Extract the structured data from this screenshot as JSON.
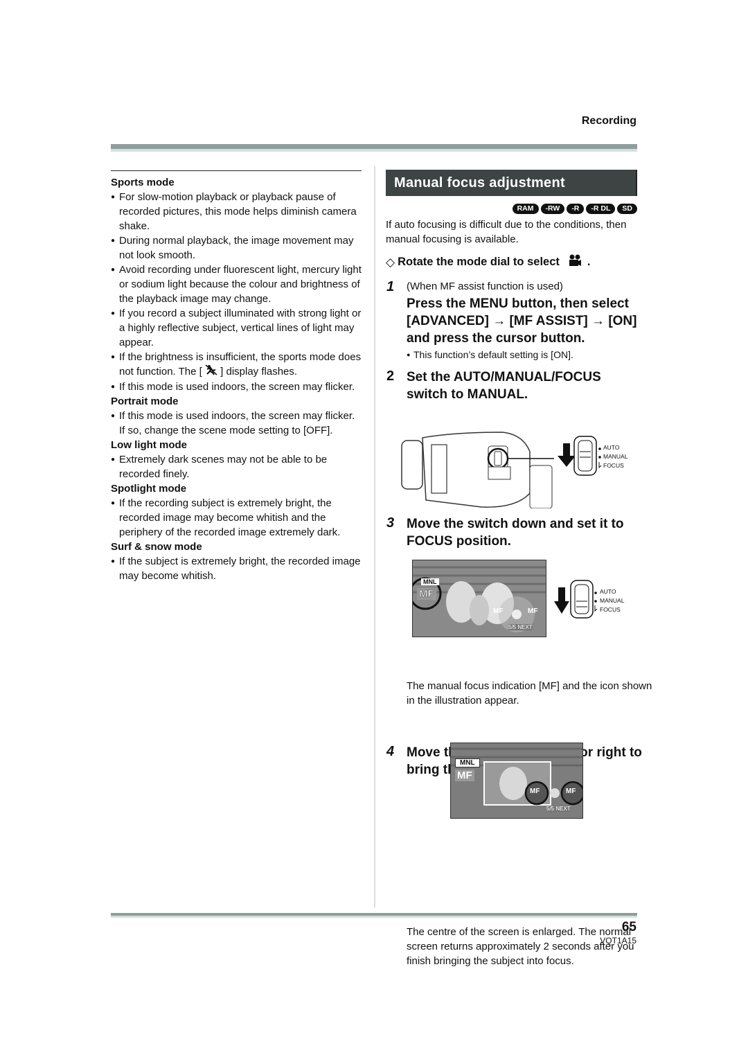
{
  "header": {
    "section": "Recording"
  },
  "left": {
    "sections": [
      {
        "title": "Sports mode",
        "bullets": [
          "For slow-motion playback or playback pause of recorded pictures, this mode helps diminish camera shake.",
          "During normal playback, the image movement may not look smooth.",
          "Avoid recording under fluorescent light, mercury light or sodium light because the colour and brightness of the playback image may change.",
          "If you record a subject illuminated with strong light or a highly reflective subject, vertical lines of light may appear.",
          "If the brightness is insufficient, the sports mode does not function. The [",
          "If this mode is used indoors, the screen may flicker."
        ],
        "bullet5_suffix": "] display flashes."
      },
      {
        "title": "Portrait mode",
        "bullets": [
          "If this mode is used indoors, the screen may flicker. If so, change the scene mode setting to [OFF]."
        ]
      },
      {
        "title": "Low light mode",
        "bullets": [
          "Extremely dark scenes may not be able to be recorded finely."
        ]
      },
      {
        "title": "Spotlight mode",
        "bullets": [
          "If the recording subject is extremely bright, the recorded image may become whitish and the periphery of the recorded image extremely dark."
        ]
      },
      {
        "title": "Surf & snow mode",
        "bullets": [
          "If the subject is extremely bright, the recorded image may become whitish."
        ]
      }
    ]
  },
  "right": {
    "title": "Manual focus adjustment",
    "badges": [
      "RAM",
      "-RW",
      "-R",
      "-R DL",
      "SD"
    ],
    "intro": "If auto focusing is difficult due to the conditions, then manual focusing is available.",
    "prep": {
      "symbol": "◇",
      "text": "Rotate the mode dial to select",
      "icon": "video-camera-icon",
      "suffix": "."
    },
    "steps": [
      {
        "num": "1",
        "lead": "(When MF assist function is used)",
        "head": "Press the MENU button, then select [ADVANCED] → [MF ASSIST] → [ON] and press the cursor button.",
        "note": "This function’s default setting is [ON]."
      },
      {
        "num": "2",
        "head": "Set the AUTO/MANUAL/FOCUS switch to MANUAL."
      },
      {
        "num": "3",
        "head": "Move the switch down and set it to FOCUS position.",
        "body": "The manual focus indication [MF] and the icon shown in the illustration appear."
      },
      {
        "num": "4",
        "head": "Move the cursor button left or right to bring the subject into focus.",
        "body": "The centre of the screen is enlarged. The normal screen returns approximately 2 seconds after you finish bringing the subject into focus."
      }
    ],
    "switch_labels": [
      "AUTO",
      "MANUAL",
      "FOCUS"
    ],
    "screen1": {
      "mode": "MNL",
      "mf": "MF",
      "minus": "MF",
      "plus": "MF",
      "page": "5/5 NEXT"
    },
    "screen2": {
      "mode": "MNL",
      "mf": "MF",
      "minus": "MF",
      "plus": "MF",
      "page": "5/5 NEXT"
    }
  },
  "footer": {
    "page_number": "65",
    "code": "VQT1A15"
  }
}
